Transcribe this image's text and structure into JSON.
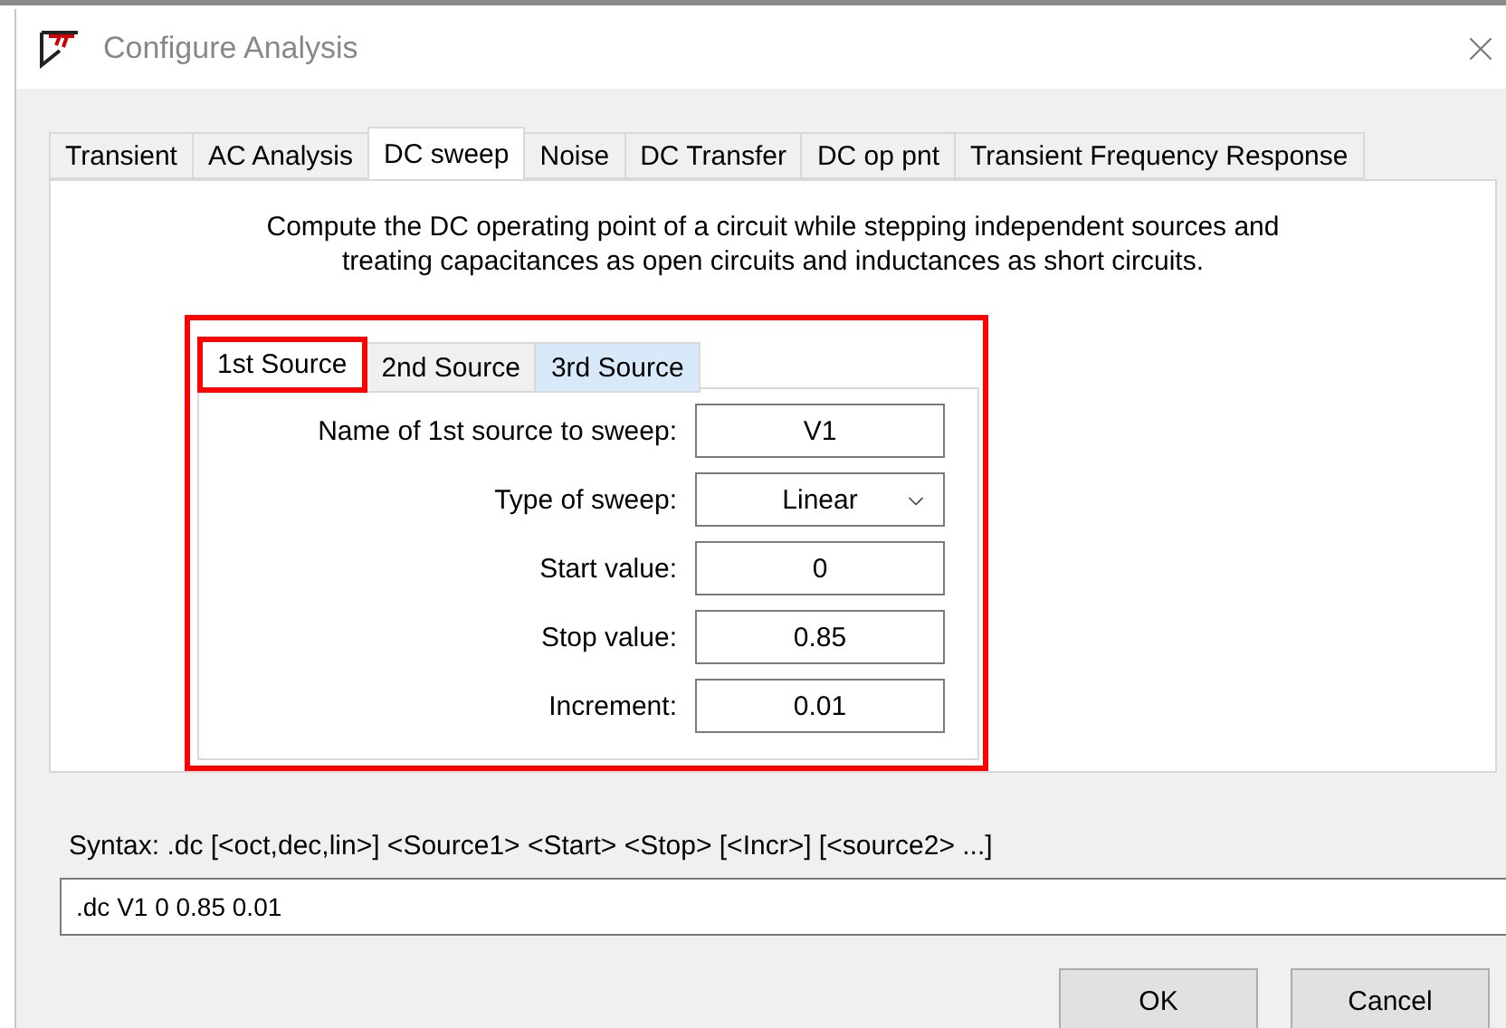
{
  "window": {
    "title": "Configure Analysis"
  },
  "tabs": [
    {
      "label": "Transient",
      "selected": false
    },
    {
      "label": "AC Analysis",
      "selected": false
    },
    {
      "label": "DC sweep",
      "selected": true
    },
    {
      "label": "Noise",
      "selected": false
    },
    {
      "label": "DC Transfer",
      "selected": false
    },
    {
      "label": "DC op pnt",
      "selected": false
    },
    {
      "label": "Transient Frequency Response",
      "selected": false
    }
  ],
  "description": [
    "Compute the DC operating point of a circuit while stepping independent sources and",
    "treating capacitances as open circuits and inductances as short circuits."
  ],
  "source_panel": {
    "highlighted": true,
    "tabs": [
      {
        "label": "1st Source",
        "selected": true,
        "hovered": false,
        "highlighted": true
      },
      {
        "label": "2nd Source",
        "selected": false,
        "hovered": false,
        "highlighted": false
      },
      {
        "label": "3rd Source",
        "selected": false,
        "hovered": true,
        "highlighted": false
      }
    ],
    "fields": [
      {
        "kind": "text",
        "label": "Name of 1st source to sweep:",
        "value": "V1"
      },
      {
        "kind": "select",
        "label": "Type of sweep:",
        "value": "Linear"
      },
      {
        "kind": "text",
        "label": "Start value:",
        "value": "0"
      },
      {
        "kind": "text",
        "label": "Stop value:",
        "value": "0.85"
      },
      {
        "kind": "text",
        "label": "Increment:",
        "value": "0.01"
      }
    ]
  },
  "syntax": "Syntax:  .dc [<oct,dec,lin>] <Source1> <Start> <Stop> [<Incr>] [<source2> ...]",
  "command": ".dc V1 0 0.85 0.01",
  "buttons": [
    "OK",
    "Cancel"
  ]
}
